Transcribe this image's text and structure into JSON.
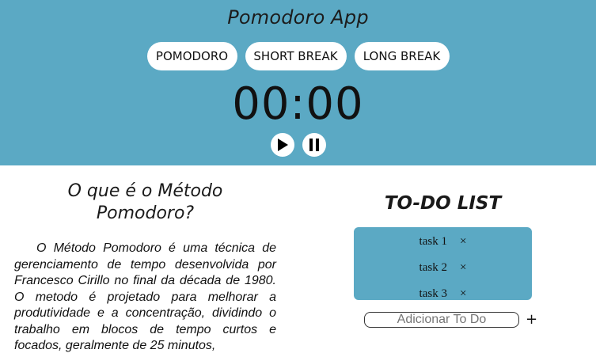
{
  "header": {
    "title": "Pomodoro App",
    "modes": [
      "POMODORO",
      "SHORT BREAK",
      "LONG BREAK"
    ],
    "timer": "00:00",
    "controls": {
      "play_icon": "play-icon",
      "pause_icon": "pause-icon"
    },
    "background_color": "#5ba9c4"
  },
  "info": {
    "title": "O que é o Método Pomodoro?",
    "text": "O Método Pomodoro é uma técnica de gerenciamento de tempo desenvolvida por Francesco Cirillo no final da década de 1980. O metodo é projetado para melhorar a produtividade e a concentração, dividindo o trabalho em blocos de tempo curtos e focados, geralmente de 25 minutos,"
  },
  "todo": {
    "title": "TO-DO LIST",
    "items": [
      {
        "label": "task 1",
        "remove": "×"
      },
      {
        "label": "task 2",
        "remove": "×"
      },
      {
        "label": "task 3",
        "remove": "×"
      }
    ],
    "input_placeholder": "Adicionar To Do",
    "add_label": "+"
  }
}
